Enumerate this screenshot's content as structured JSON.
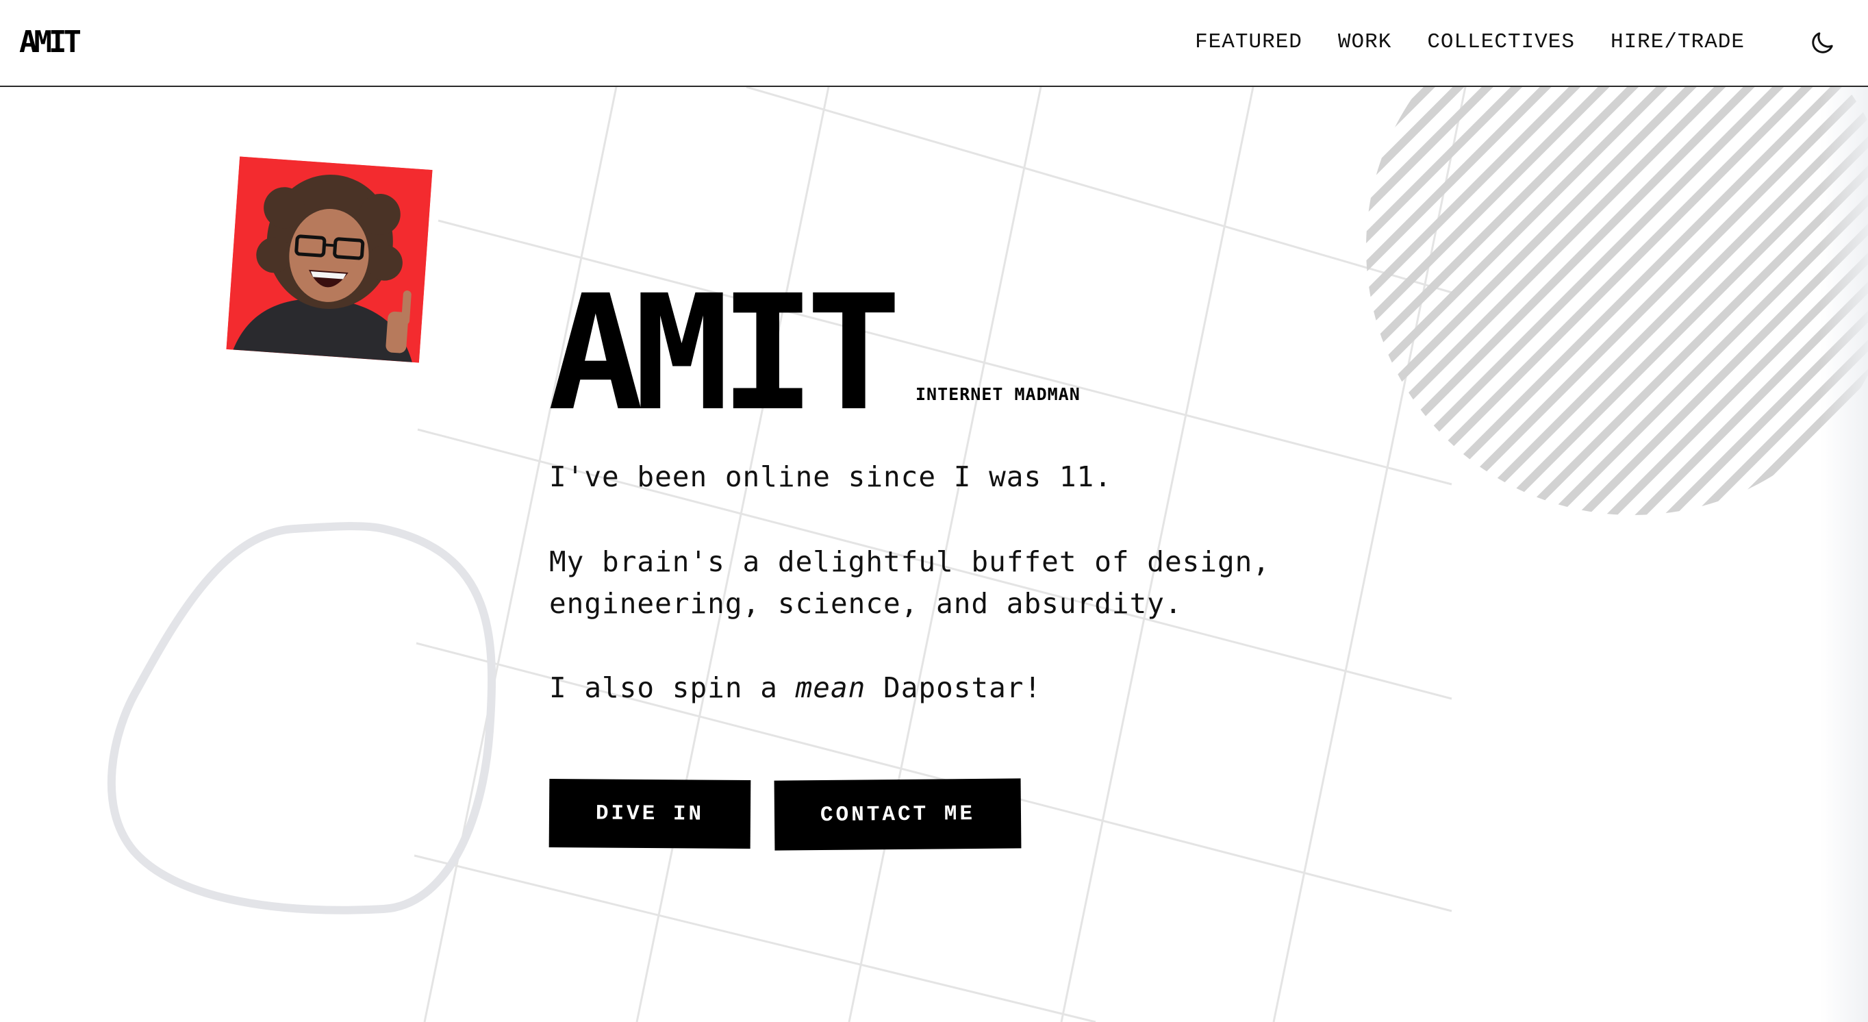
{
  "header": {
    "logo": "AMIT",
    "nav": [
      {
        "label": "FEATURED"
      },
      {
        "label": "WORK"
      },
      {
        "label": "COLLECTIVES"
      },
      {
        "label": "HIRE/TRADE"
      }
    ],
    "theme_toggle_icon": "moon-icon"
  },
  "hero": {
    "title": "AMIT",
    "subtitle": "INTERNET MADMAN",
    "bio_1": "I've been online since I was 11.",
    "bio_2_line_1": "My brain's a delightful buffet of design,",
    "bio_2_line_2": "engineering, science, and absurdity.",
    "bio_3_before": "I also spin a ",
    "bio_3_em": "mean",
    "bio_3_after": " Dapostar!",
    "buttons": {
      "dive_in": "DIVE IN",
      "contact_me": "CONTACT ME"
    }
  },
  "colors": {
    "portrait_background": "#f32b2f",
    "text": "#0a0a0a",
    "button_background": "#000000",
    "button_text": "#ffffff",
    "grid_lines": "#e4e4e4",
    "blob_outline": "#e3e4e8",
    "hatch": "#d2d2d2"
  }
}
